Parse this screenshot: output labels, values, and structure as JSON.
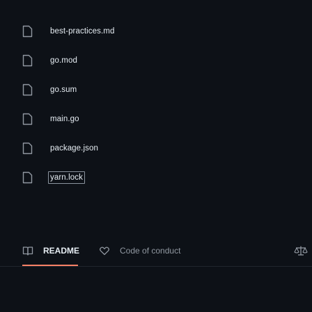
{
  "files": [
    {
      "name": "best-practices.md",
      "icon": "file-icon"
    },
    {
      "name": "go.mod",
      "icon": "file-icon"
    },
    {
      "name": "go.sum",
      "icon": "file-icon"
    },
    {
      "name": "main.go",
      "icon": "file-icon"
    },
    {
      "name": "package.json",
      "icon": "file-icon"
    },
    {
      "name": "yarn.lock",
      "icon": "file-icon"
    }
  ],
  "tabs": [
    {
      "label": "README",
      "icon": "book-icon",
      "active": true
    },
    {
      "label": "Code of conduct",
      "icon": "heart-icon",
      "active": false
    }
  ],
  "overflow_icon": "scale-icon",
  "colors": {
    "background": "#0d1117",
    "text": "#e6edf3",
    "muted": "#9198a1",
    "accent": "#f78166"
  }
}
